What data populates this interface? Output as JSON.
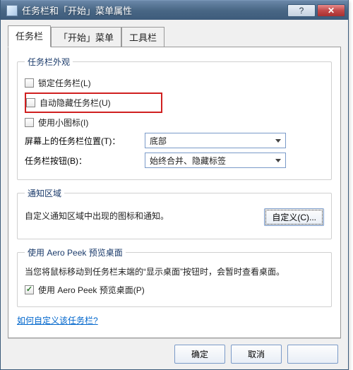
{
  "window": {
    "title": "任务栏和「开始」菜单属性"
  },
  "tabs": {
    "taskbar": "任务栏",
    "startmenu": "「开始」菜单",
    "toolbar": "工具栏"
  },
  "appearance": {
    "legend": "任务栏外观",
    "lock": "锁定任务栏(L)",
    "autohide": "自动隐藏任务栏(U)",
    "smallicons": "使用小图标(I)",
    "position_label": "屏幕上的任务栏位置(T)：",
    "position_value": "底部",
    "buttons_label": "任务栏按钮(B)：",
    "buttons_value": "始终合并、隐藏标签"
  },
  "notify": {
    "legend": "通知区域",
    "desc": "自定义通知区域中出现的图标和通知。",
    "customize": "自定义(C)..."
  },
  "aero": {
    "legend": "使用 Aero Peek 预览桌面",
    "desc": "当您将鼠标移动到任务栏末端的“显示桌面”按钮时，会暂时查看桌面。",
    "checkbox": "使用 Aero Peek 预览桌面(P)"
  },
  "link": "如何自定义该任务栏?",
  "footer": {
    "ok": "确定",
    "cancel": "取消",
    "apply": ""
  }
}
